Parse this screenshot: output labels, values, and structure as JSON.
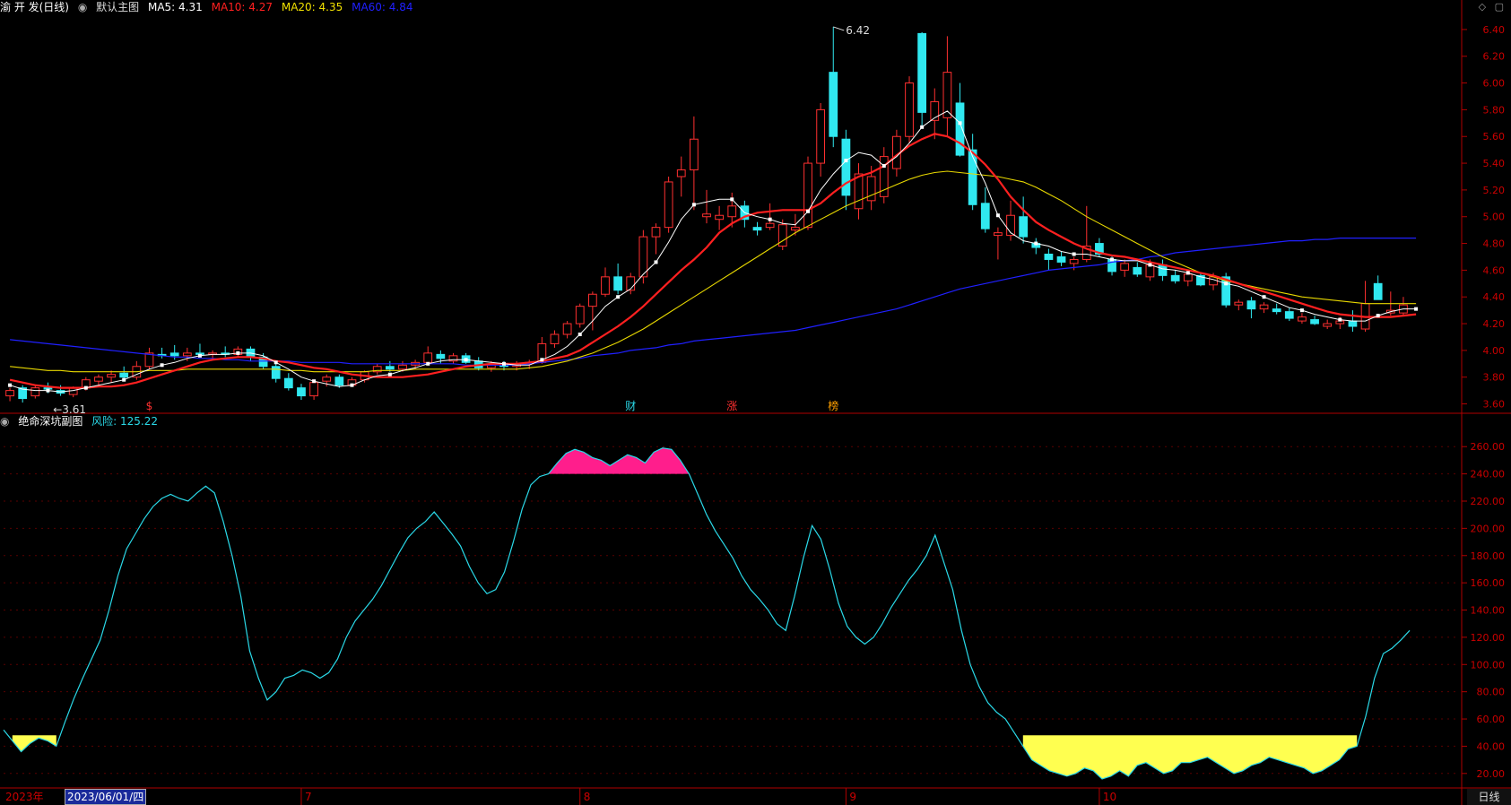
{
  "header": {
    "stock": "渝 开 发(日线)",
    "template": "默认主图",
    "ma5": {
      "label": "MA5: 4.31",
      "color": "#ffffff"
    },
    "ma10": {
      "label": "MA10: 4.27",
      "color": "#ff2020"
    },
    "ma20": {
      "label": "MA20: 4.35",
      "color": "#f0e000"
    },
    "ma60": {
      "label": "MA60: 4.84",
      "color": "#2020ff"
    }
  },
  "sub_header": {
    "indicator": "绝命深坑副图",
    "risk_label": "风险: 125.22",
    "risk_color": "#2ad9e8"
  },
  "top_icons": [
    "diamond-icon",
    "window-icon"
  ],
  "annotations": {
    "high": "6.42",
    "low": "3.61"
  },
  "markers": [
    {
      "text": "$",
      "color": "#ff3030"
    },
    {
      "text": "财",
      "color": "#2ad9e8"
    },
    {
      "text": "涨",
      "color": "#ff3030"
    },
    {
      "text": "榜",
      "color": "#ffa000"
    }
  ],
  "bottom": {
    "year_label": "2023年",
    "date_selected": "2023/06/01/四",
    "month_labels": [
      "7",
      "8",
      "9",
      "10"
    ],
    "period_button": "日线"
  },
  "colors": {
    "up": "#ff3030",
    "down": "#30e8f0",
    "grid": "#5a0000",
    "risk_high": "#ff1e8c",
    "risk_low": "#ffff50",
    "risk_line": "#2ad9e8"
  },
  "chart_data": [
    {
      "type": "candlestick",
      "y_ticks": [
        "6.40",
        "6.20",
        "6.00",
        "5.80",
        "5.60",
        "5.40",
        "5.20",
        "5.00",
        "4.80",
        "4.60",
        "4.40",
        "4.20",
        "4.00",
        "3.80",
        "3.60"
      ],
      "ylim": [
        3.55,
        6.5
      ],
      "candles": [
        [
          3.66,
          3.72,
          3.62,
          3.7
        ],
        [
          3.72,
          3.74,
          3.61,
          3.64
        ],
        [
          3.66,
          3.74,
          3.64,
          3.72
        ],
        [
          3.72,
          3.76,
          3.68,
          3.71
        ],
        [
          3.7,
          3.74,
          3.66,
          3.68
        ],
        [
          3.67,
          3.73,
          3.65,
          3.72
        ],
        [
          3.72,
          3.8,
          3.7,
          3.78
        ],
        [
          3.77,
          3.82,
          3.74,
          3.8
        ],
        [
          3.8,
          3.85,
          3.76,
          3.82
        ],
        [
          3.83,
          3.88,
          3.78,
          3.8
        ],
        [
          3.8,
          3.92,
          3.78,
          3.88
        ],
        [
          3.88,
          4.02,
          3.86,
          3.98
        ],
        [
          3.97,
          4.02,
          3.94,
          3.96
        ],
        [
          3.98,
          4.04,
          3.93,
          3.96
        ],
        [
          3.96,
          4.02,
          3.92,
          3.98
        ],
        [
          3.98,
          4.05,
          3.95,
          3.97
        ],
        [
          3.97,
          4.0,
          3.93,
          3.98
        ],
        [
          3.98,
          4.03,
          3.95,
          3.97
        ],
        [
          3.97,
          4.03,
          3.95,
          4.01
        ],
        [
          4.01,
          4.03,
          3.92,
          3.95
        ],
        [
          3.95,
          3.98,
          3.86,
          3.88
        ],
        [
          3.88,
          3.91,
          3.76,
          3.79
        ],
        [
          3.79,
          3.83,
          3.7,
          3.72
        ],
        [
          3.72,
          3.75,
          3.63,
          3.66
        ],
        [
          3.66,
          3.78,
          3.63,
          3.76
        ],
        [
          3.77,
          3.82,
          3.73,
          3.8
        ],
        [
          3.8,
          3.82,
          3.72,
          3.74
        ],
        [
          3.74,
          3.8,
          3.73,
          3.78
        ],
        [
          3.78,
          3.85,
          3.76,
          3.84
        ],
        [
          3.84,
          3.9,
          3.82,
          3.88
        ],
        [
          3.88,
          3.92,
          3.84,
          3.86
        ],
        [
          3.86,
          3.92,
          3.84,
          3.89
        ],
        [
          3.89,
          3.93,
          3.86,
          3.91
        ],
        [
          3.91,
          4.03,
          3.89,
          3.98
        ],
        [
          3.97,
          4.0,
          3.9,
          3.94
        ],
        [
          3.92,
          3.98,
          3.9,
          3.96
        ],
        [
          3.96,
          3.98,
          3.9,
          3.91
        ],
        [
          3.92,
          3.95,
          3.85,
          3.87
        ],
        [
          3.87,
          3.92,
          3.84,
          3.89
        ],
        [
          3.89,
          3.92,
          3.85,
          3.88
        ],
        [
          3.88,
          3.92,
          3.85,
          3.9
        ],
        [
          3.9,
          3.93,
          3.86,
          3.91
        ],
        [
          3.91,
          4.1,
          3.9,
          4.05
        ],
        [
          4.05,
          4.15,
          4.02,
          4.12
        ],
        [
          4.12,
          4.22,
          4.09,
          4.2
        ],
        [
          4.2,
          4.35,
          4.17,
          4.33
        ],
        [
          4.33,
          4.44,
          4.15,
          4.42
        ],
        [
          4.42,
          4.62,
          4.4,
          4.55
        ],
        [
          4.55,
          4.65,
          4.42,
          4.45
        ],
        [
          4.45,
          4.58,
          4.42,
          4.55
        ],
        [
          4.55,
          4.9,
          4.5,
          4.85
        ],
        [
          4.85,
          4.95,
          4.72,
          4.92
        ],
        [
          4.92,
          5.3,
          4.88,
          5.26
        ],
        [
          5.3,
          5.45,
          5.15,
          5.35
        ],
        [
          5.35,
          5.75,
          5.05,
          5.58
        ],
        [
          5.0,
          5.2,
          4.95,
          5.02
        ],
        [
          4.98,
          5.08,
          4.9,
          5.01
        ],
        [
          5.0,
          5.18,
          4.92,
          5.08
        ],
        [
          5.08,
          5.12,
          4.92,
          4.98
        ],
        [
          4.92,
          4.96,
          4.86,
          4.9
        ],
        [
          4.92,
          5.1,
          4.9,
          4.95
        ],
        [
          4.78,
          4.98,
          4.75,
          4.94
        ],
        [
          4.9,
          5.02,
          4.86,
          4.92
        ],
        [
          4.92,
          5.45,
          4.9,
          5.4
        ],
        [
          5.4,
          5.85,
          5.3,
          5.8
        ],
        [
          6.08,
          6.42,
          5.52,
          5.6
        ],
        [
          5.58,
          5.65,
          5.05,
          5.16
        ],
        [
          5.06,
          5.4,
          4.98,
          5.32
        ],
        [
          5.12,
          5.38,
          5.05,
          5.3
        ],
        [
          5.15,
          5.52,
          5.1,
          5.45
        ],
        [
          5.36,
          5.65,
          5.3,
          5.6
        ],
        [
          5.6,
          6.05,
          5.55,
          6.0
        ],
        [
          6.37,
          6.38,
          5.68,
          5.78
        ],
        [
          5.72,
          5.96,
          5.58,
          5.86
        ],
        [
          5.74,
          6.35,
          5.6,
          6.08
        ],
        [
          5.85,
          6.0,
          5.45,
          5.46
        ],
        [
          5.5,
          5.62,
          5.05,
          5.09
        ],
        [
          5.1,
          5.22,
          4.88,
          4.91
        ],
        [
          4.86,
          4.92,
          4.68,
          4.88
        ],
        [
          4.86,
          5.12,
          4.82,
          5.01
        ],
        [
          5.0,
          5.15,
          4.8,
          4.85
        ],
        [
          4.8,
          4.84,
          4.72,
          4.77
        ],
        [
          4.72,
          4.76,
          4.6,
          4.68
        ],
        [
          4.7,
          4.74,
          4.63,
          4.66
        ],
        [
          4.65,
          4.7,
          4.6,
          4.68
        ],
        [
          4.68,
          5.08,
          4.66,
          4.78
        ],
        [
          4.8,
          4.84,
          4.7,
          4.72
        ],
        [
          4.68,
          4.71,
          4.56,
          4.59
        ],
        [
          4.6,
          4.68,
          4.55,
          4.65
        ],
        [
          4.62,
          4.66,
          4.55,
          4.57
        ],
        [
          4.55,
          4.68,
          4.52,
          4.64
        ],
        [
          4.64,
          4.68,
          4.52,
          4.56
        ],
        [
          4.56,
          4.6,
          4.5,
          4.52
        ],
        [
          4.52,
          4.58,
          4.48,
          4.57
        ],
        [
          4.56,
          4.58,
          4.48,
          4.49
        ],
        [
          4.49,
          4.58,
          4.45,
          4.55
        ],
        [
          4.55,
          4.58,
          4.32,
          4.34
        ],
        [
          4.34,
          4.38,
          4.3,
          4.36
        ],
        [
          4.37,
          4.4,
          4.24,
          4.31
        ],
        [
          4.31,
          4.36,
          4.28,
          4.34
        ],
        [
          4.31,
          4.35,
          4.27,
          4.29
        ],
        [
          4.29,
          4.32,
          4.22,
          4.24
        ],
        [
          4.22,
          4.28,
          4.2,
          4.25
        ],
        [
          4.23,
          4.26,
          4.19,
          4.2
        ],
        [
          4.18,
          4.23,
          4.16,
          4.2
        ],
        [
          4.2,
          4.25,
          4.16,
          4.22
        ],
        [
          4.22,
          4.3,
          4.14,
          4.18
        ],
        [
          4.16,
          4.52,
          4.14,
          4.35
        ],
        [
          4.5,
          4.56,
          4.38,
          4.38
        ],
        [
          4.28,
          4.44,
          4.26,
          4.3
        ],
        [
          4.28,
          4.4,
          4.26,
          4.34
        ]
      ],
      "ma5": [
        3.74,
        3.71,
        3.7,
        3.7,
        3.69,
        3.7,
        3.72,
        3.74,
        3.76,
        3.78,
        3.82,
        3.86,
        3.89,
        3.91,
        3.94,
        3.96,
        3.97,
        3.97,
        3.98,
        3.98,
        3.96,
        3.91,
        3.86,
        3.8,
        3.77,
        3.75,
        3.73,
        3.74,
        3.78,
        3.81,
        3.82,
        3.85,
        3.87,
        3.9,
        3.92,
        3.93,
        3.93,
        3.92,
        3.91,
        3.9,
        3.89,
        3.89,
        3.93,
        3.97,
        4.03,
        4.12,
        4.22,
        4.33,
        4.4,
        4.46,
        4.57,
        4.66,
        4.81,
        4.98,
        5.09,
        5.11,
        5.13,
        5.13,
        5.03,
        5.0,
        4.98,
        4.95,
        4.94,
        5.04,
        5.2,
        5.32,
        5.42,
        5.48,
        5.46,
        5.38,
        5.45,
        5.55,
        5.67,
        5.74,
        5.79,
        5.7,
        5.45,
        5.25,
        5.01,
        4.88,
        4.82,
        4.8,
        4.78,
        4.74,
        4.72,
        4.72,
        4.7,
        4.68,
        4.67,
        4.67,
        4.64,
        4.61,
        4.6,
        4.58,
        4.55,
        4.53,
        4.5,
        4.48,
        4.44,
        4.4,
        4.36,
        4.32,
        4.3,
        4.27,
        4.25,
        4.23,
        4.22,
        4.22,
        4.26,
        4.29,
        4.31,
        4.31
      ],
      "ma10": [
        3.78,
        3.76,
        3.74,
        3.73,
        3.72,
        3.72,
        3.72,
        3.73,
        3.73,
        3.74,
        3.76,
        3.79,
        3.82,
        3.85,
        3.88,
        3.91,
        3.93,
        3.94,
        3.95,
        3.95,
        3.94,
        3.92,
        3.91,
        3.89,
        3.87,
        3.86,
        3.84,
        3.82,
        3.81,
        3.8,
        3.8,
        3.8,
        3.81,
        3.82,
        3.84,
        3.86,
        3.88,
        3.89,
        3.9,
        3.9,
        3.9,
        3.91,
        3.92,
        3.94,
        3.96,
        4.0,
        4.06,
        4.12,
        4.18,
        4.25,
        4.33,
        4.42,
        4.51,
        4.6,
        4.68,
        4.77,
        4.88,
        4.95,
        5.0,
        5.03,
        5.04,
        5.05,
        5.05,
        5.05,
        5.1,
        5.18,
        5.25,
        5.3,
        5.33,
        5.38,
        5.46,
        5.53,
        5.58,
        5.62,
        5.6,
        5.55,
        5.48,
        5.39,
        5.28,
        5.15,
        5.05,
        4.96,
        4.9,
        4.85,
        4.8,
        4.76,
        4.73,
        4.71,
        4.7,
        4.68,
        4.66,
        4.64,
        4.62,
        4.6,
        4.58,
        4.56,
        4.53,
        4.5,
        4.47,
        4.44,
        4.41,
        4.38,
        4.35,
        4.32,
        4.29,
        4.27,
        4.26,
        4.25,
        4.25,
        4.25,
        4.26,
        4.27
      ],
      "ma20": [
        3.88,
        3.87,
        3.86,
        3.85,
        3.85,
        3.84,
        3.84,
        3.84,
        3.84,
        3.84,
        3.84,
        3.85,
        3.85,
        3.85,
        3.86,
        3.86,
        3.86,
        3.86,
        3.86,
        3.86,
        3.86,
        3.86,
        3.85,
        3.85,
        3.84,
        3.84,
        3.84,
        3.84,
        3.84,
        3.85,
        3.85,
        3.85,
        3.86,
        3.86,
        3.86,
        3.86,
        3.86,
        3.86,
        3.86,
        3.86,
        3.86,
        3.87,
        3.88,
        3.9,
        3.92,
        3.95,
        3.98,
        4.02,
        4.06,
        4.11,
        4.16,
        4.22,
        4.28,
        4.34,
        4.4,
        4.46,
        4.52,
        4.58,
        4.64,
        4.7,
        4.76,
        4.82,
        4.88,
        4.93,
        4.98,
        5.03,
        5.08,
        5.12,
        5.16,
        5.2,
        5.24,
        5.28,
        5.31,
        5.33,
        5.34,
        5.33,
        5.32,
        5.31,
        5.3,
        5.28,
        5.26,
        5.22,
        5.17,
        5.12,
        5.06,
        5.0,
        4.95,
        4.9,
        4.85,
        4.8,
        4.75,
        4.7,
        4.66,
        4.62,
        4.58,
        4.55,
        4.52,
        4.5,
        4.48,
        4.46,
        4.44,
        4.42,
        4.4,
        4.39,
        4.38,
        4.37,
        4.36,
        4.35,
        4.35,
        4.35,
        4.35,
        4.35
      ],
      "ma60": [
        4.08,
        4.07,
        4.06,
        4.05,
        4.04,
        4.03,
        4.02,
        4.01,
        4.0,
        3.99,
        3.98,
        3.97,
        3.96,
        3.95,
        3.95,
        3.94,
        3.94,
        3.93,
        3.93,
        3.92,
        3.92,
        3.92,
        3.92,
        3.91,
        3.91,
        3.91,
        3.91,
        3.9,
        3.9,
        3.9,
        3.9,
        3.9,
        3.9,
        3.9,
        3.9,
        3.9,
        3.89,
        3.89,
        3.89,
        3.89,
        3.89,
        3.9,
        3.91,
        3.92,
        3.93,
        3.94,
        3.96,
        3.97,
        3.98,
        4.0,
        4.01,
        4.02,
        4.04,
        4.05,
        4.07,
        4.08,
        4.09,
        4.1,
        4.11,
        4.12,
        4.13,
        4.14,
        4.15,
        4.17,
        4.19,
        4.21,
        4.23,
        4.25,
        4.27,
        4.29,
        4.31,
        4.34,
        4.37,
        4.4,
        4.43,
        4.46,
        4.48,
        4.5,
        4.52,
        4.54,
        4.56,
        4.58,
        4.6,
        4.61,
        4.62,
        4.63,
        4.64,
        4.66,
        4.67,
        4.68,
        4.7,
        4.71,
        4.73,
        4.74,
        4.75,
        4.76,
        4.77,
        4.78,
        4.79,
        4.8,
        4.81,
        4.82,
        4.82,
        4.83,
        4.83,
        4.84,
        4.84,
        4.84,
        4.84,
        4.84,
        4.84,
        4.84
      ]
    },
    {
      "type": "line",
      "title": "绝命深坑副图",
      "y_ticks": [
        "260.00",
        "240.00",
        "220.00",
        "200.00",
        "180.00",
        "160.00",
        "140.00",
        "120.00",
        "100.00",
        "80.00",
        "60.00",
        "40.00",
        "20.00"
      ],
      "ylim": [
        10,
        272
      ],
      "thresholds": {
        "high": 240,
        "low": 48
      },
      "values": [
        52,
        44,
        36,
        42,
        46,
        44,
        40,
        58,
        75,
        90,
        104,
        118,
        140,
        165,
        185,
        196,
        207,
        216,
        222,
        225,
        222,
        220,
        226,
        231,
        226,
        205,
        180,
        150,
        110,
        90,
        74,
        80,
        90,
        92,
        96,
        94,
        90,
        94,
        104,
        120,
        132,
        140,
        148,
        158,
        170,
        182,
        193,
        200,
        205,
        212,
        204,
        196,
        187,
        172,
        160,
        152,
        155,
        168,
        190,
        214,
        232,
        238,
        240,
        248,
        255,
        258,
        256,
        252,
        250,
        246,
        250,
        254,
        252,
        248,
        256,
        259,
        258,
        250,
        240,
        225,
        210,
        198,
        188,
        178,
        165,
        155,
        148,
        140,
        130,
        125,
        150,
        178,
        202,
        192,
        170,
        145,
        128,
        120,
        115,
        120,
        130,
        142,
        152,
        162,
        170,
        180,
        195,
        175,
        155,
        125,
        100,
        84,
        72,
        65,
        60,
        50,
        40,
        30,
        26,
        22,
        20,
        18,
        20,
        24,
        22,
        16,
        18,
        22,
        18,
        26,
        28,
        24,
        20,
        22,
        28,
        28,
        30,
        32,
        28,
        24,
        20,
        22,
        26,
        28,
        32,
        30,
        28,
        26,
        24,
        20,
        22,
        26,
        30,
        38,
        40,
        62,
        90,
        108,
        112,
        118,
        125
      ]
    }
  ]
}
